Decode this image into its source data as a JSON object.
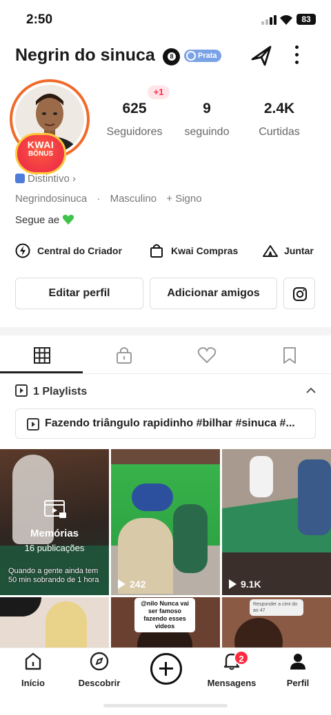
{
  "status_bar": {
    "time": "2:50",
    "battery": "83"
  },
  "profile": {
    "name": "Negrin do sinuca",
    "badge": "Prata",
    "follower_delta": "+1",
    "stats": [
      {
        "value": "625",
        "label": "Seguidores"
      },
      {
        "value": "9",
        "label": "seguindo"
      },
      {
        "value": "2.4K",
        "label": "Curtidas"
      }
    ],
    "kwai_bonus": {
      "line1": "KWAI",
      "line2": "BÔNUS"
    },
    "distintivo": "Distintivo",
    "handle": "Negrindosinuca",
    "gender": "Masculino",
    "sign": "+ Signo",
    "bio": "Segue ae"
  },
  "quick_links": [
    "Central do Criador",
    "Kwai Compras",
    "Juntar"
  ],
  "buttons": {
    "edit": "Editar perfil",
    "add_friends": "Adicionar amigos"
  },
  "tabs": [
    "posts-grid-icon",
    "private-lock-icon",
    "liked-heart-icon",
    "saved-bookmark-icon"
  ],
  "playlists": {
    "header": "1 Playlists",
    "item": "Fazendo triângulo rapidinho #bilhar #sinuca #..."
  },
  "grid": {
    "memories": {
      "title": "Memórias",
      "subtitle": "16 publicações",
      "caption": "Quando a gente ainda tem 50 min sobrando de 1 hora"
    },
    "views": [
      "242",
      "9.1K"
    ],
    "overlay_text": "@nilo Nunca vai ser famoso fazendo esses videos",
    "overlay_text_2": "Responder a cimi do ao 47"
  },
  "nav": {
    "items": [
      {
        "label": "Início"
      },
      {
        "label": "Descobrir"
      },
      {
        "label": "Mensagens",
        "badge": "2"
      },
      {
        "label": "Perfil"
      }
    ]
  },
  "colors": {
    "accent": "#ff2a40",
    "ring": "#f06a2a",
    "badge": "#7aa2e6",
    "heart": "#3ec44a"
  }
}
